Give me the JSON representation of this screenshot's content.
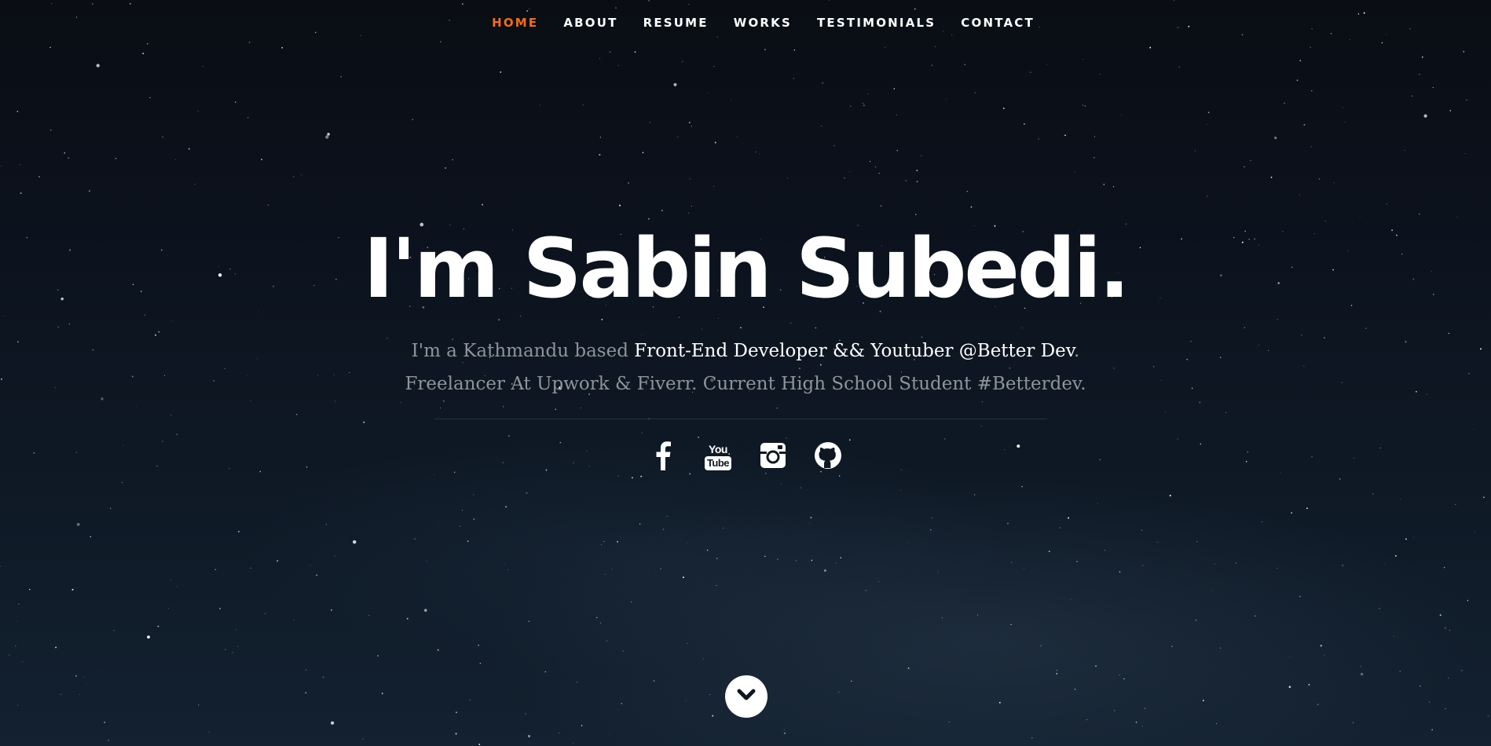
{
  "nav": {
    "items": [
      {
        "label": "HOME",
        "active": true
      },
      {
        "label": "ABOUT",
        "active": false
      },
      {
        "label": "RESUME",
        "active": false
      },
      {
        "label": "WORKS",
        "active": false
      },
      {
        "label": "TESTIMONIALS",
        "active": false
      },
      {
        "label": "CONTACT",
        "active": false
      }
    ]
  },
  "banner": {
    "headline": "I'm Sabin Subedi.",
    "tagline_pre": "I'm a Kathmandu based ",
    "tagline_highlight": "Front-End Developer && Youtuber @Better Dev",
    "tagline_post": ".",
    "tagline_line2": "Freelancer At Upwork & Fiverr. Current High School Student #Betterdev."
  },
  "social": {
    "facebook_icon": "facebook-icon",
    "youtube_icon": "youtube-icon",
    "youtube_you": "You",
    "youtube_tube": "Tube",
    "instagram_icon": "instagram-icon",
    "github_icon": "github-icon"
  },
  "scroll": {
    "icon": "chevron-down-icon"
  },
  "colors": {
    "accent": "#f06d1e",
    "text": "#ffffff",
    "muted": "#8f949a",
    "background": "#0c131e"
  }
}
